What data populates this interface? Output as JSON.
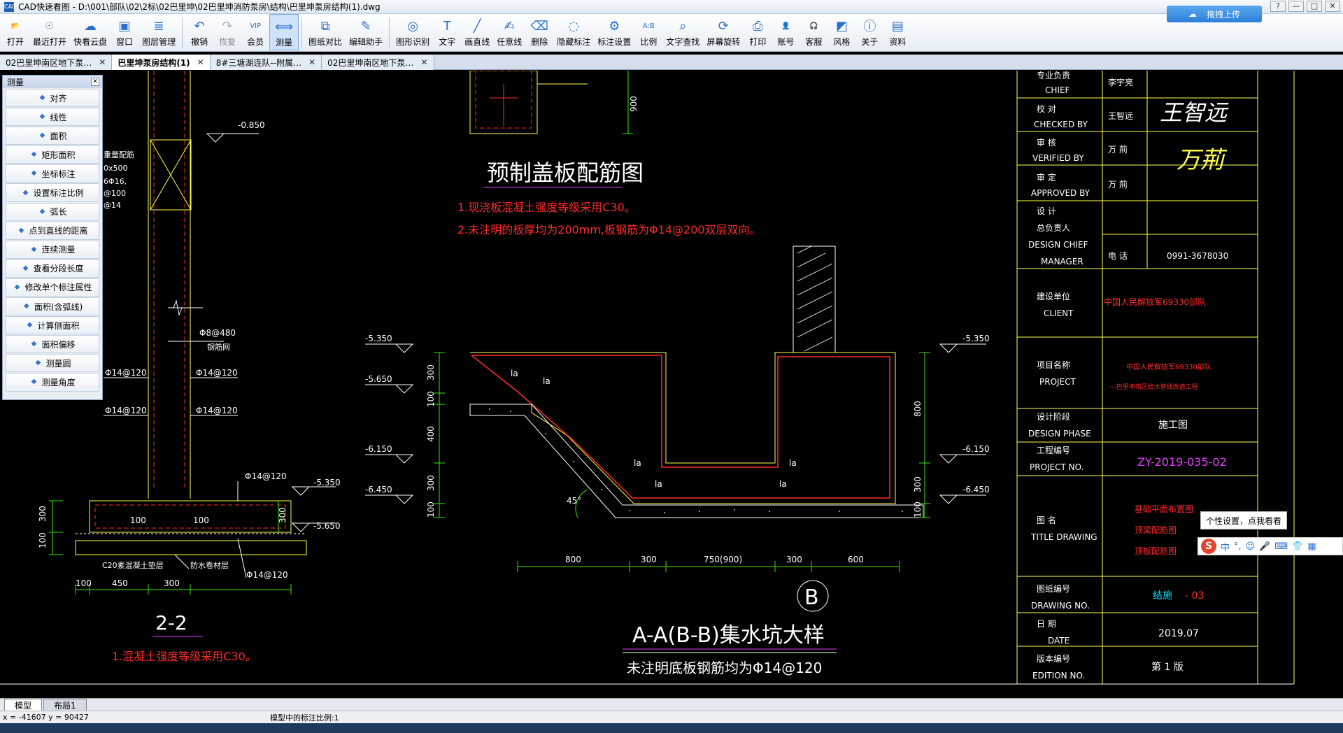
{
  "window": {
    "title": "CAD快速看图 - D:\\001\\部队\\02\\2标\\02巴里坤\\02巴里坤消防泵房\\结构\\巴里坤泵房结构(1).dwg",
    "app_icon": "CAD",
    "buttons": [
      "?",
      "—",
      "□",
      "✕"
    ]
  },
  "toolbar": {
    "items": [
      {
        "label": "打开",
        "icon": "folder-icon",
        "glyph": "📂"
      },
      {
        "label": "最近打开",
        "icon": "clock-icon",
        "glyph": "🕘"
      },
      {
        "label": "快看云盘",
        "icon": "cloud-icon",
        "glyph": "☁"
      },
      {
        "label": "窗口",
        "icon": "window-icon",
        "glyph": "▣"
      },
      {
        "label": "图层管理",
        "icon": "layers-icon",
        "glyph": "≣"
      },
      {
        "label": "撤销",
        "icon": "undo-icon",
        "glyph": "↶"
      },
      {
        "label": "恢复",
        "icon": "redo-icon",
        "glyph": "↷"
      },
      {
        "label": "会员",
        "icon": "vip-icon",
        "glyph": "VIP"
      },
      {
        "label": "测量",
        "icon": "measure-icon",
        "glyph": "⟺"
      },
      {
        "label": "图纸对比",
        "icon": "compare-icon",
        "glyph": "⧉"
      },
      {
        "label": "编辑助手",
        "icon": "edit-helper-icon",
        "glyph": "✎"
      },
      {
        "label": "图形识别",
        "icon": "shape-recognize-icon",
        "glyph": "◎"
      },
      {
        "label": "文字",
        "icon": "text-icon",
        "glyph": "T"
      },
      {
        "label": "画直线",
        "icon": "line-icon",
        "glyph": "╱"
      },
      {
        "label": "任意线",
        "icon": "freehand-icon",
        "glyph": "✍"
      },
      {
        "label": "删除",
        "icon": "eraser-icon",
        "glyph": "⌫"
      },
      {
        "label": "隐藏标注",
        "icon": "hide-icon",
        "glyph": "◌"
      },
      {
        "label": "标注设置",
        "icon": "annotation-settings-icon",
        "glyph": "⚙"
      },
      {
        "label": "比例",
        "icon": "scale-icon",
        "glyph": "A:B"
      },
      {
        "label": "文字查找",
        "icon": "find-text-icon",
        "glyph": "⌕"
      },
      {
        "label": "屏幕旋转",
        "icon": "rotate-icon",
        "glyph": "⟳"
      },
      {
        "label": "打印",
        "icon": "print-icon",
        "glyph": "⎙"
      },
      {
        "label": "账号",
        "icon": "account-icon",
        "glyph": "👤"
      },
      {
        "label": "客服",
        "icon": "support-icon",
        "glyph": "🎧"
      },
      {
        "label": "风格",
        "icon": "style-icon",
        "glyph": "◩"
      },
      {
        "label": "关于",
        "icon": "about-icon",
        "glyph": "ⓘ"
      },
      {
        "label": "资料",
        "icon": "docs-icon",
        "glyph": "▤"
      }
    ],
    "upload_label": "拖拽上传"
  },
  "tabs": [
    {
      "label": "02巴里坤南区地下泵…",
      "active": false
    },
    {
      "label": "巴里坤泵房结构(1)",
      "active": true
    },
    {
      "label": "8#三塘湖连队--附属…",
      "active": false
    },
    {
      "label": "02巴里坤南区地下泵…",
      "active": false
    }
  ],
  "measure_panel": {
    "title": "测量",
    "items": [
      {
        "label": "对齐",
        "icon": "align-measure-icon"
      },
      {
        "label": "线性",
        "icon": "linear-measure-icon"
      },
      {
        "label": "面积",
        "icon": "area-icon"
      },
      {
        "label": "矩形面积",
        "icon": "rect-area-icon"
      },
      {
        "label": "坐标标注",
        "icon": "coordinate-icon"
      },
      {
        "label": "设置标注比例",
        "icon": "scale-setting-icon"
      },
      {
        "label": "弧长",
        "icon": "arc-length-icon"
      },
      {
        "label": "点到直线的距离",
        "icon": "point-line-distance-icon"
      },
      {
        "label": "连续测量",
        "icon": "continuous-measure-icon"
      },
      {
        "label": "查看分段长度",
        "icon": "segment-length-icon"
      },
      {
        "label": "修改单个标注属性",
        "icon": "edit-annotation-icon"
      },
      {
        "label": "面积(含弧线)",
        "icon": "arc-area-icon"
      },
      {
        "label": "计算侧面积",
        "icon": "side-area-icon"
      },
      {
        "label": "面积偏移",
        "icon": "area-offset-icon"
      },
      {
        "label": "测量圆",
        "icon": "circle-measure-icon"
      },
      {
        "label": "测量角度",
        "icon": "angle-measure-icon"
      }
    ]
  },
  "drawing": {
    "left_dims": {
      "elev_top": "-0.850",
      "note_block": [
        "重量配筋",
        "0x500",
        "6Φ16,",
        "@100",
        "@14"
      ],
      "phi8": "Φ8@480",
      "mark": "钢筋网",
      "r1l": "Φ14@120",
      "r1r": "Φ14@120",
      "r2l": "Φ14@120",
      "r2r": "Φ14@120",
      "r3": "Φ14@120",
      "elev_a": "-5.350",
      "elev_b": "-5.650",
      "v300": "300",
      "v100": "100",
      "d100a": "100",
      "d100b": "100",
      "d300": "300",
      "bed": "C20素混凝土垫层",
      "waterproof": "防水卷材层",
      "r4": "Φ14@120",
      "b100": "100",
      "b450": "450",
      "b300": "300",
      "section": "2-2",
      "note": "1.混凝土强度等级采用C30。"
    },
    "cover": {
      "dim900": "900",
      "title": "预制盖板配筋图",
      "note1": "1.现浇板混凝土强度等级采用C30。",
      "note2": "2.未注明的板厚均为200mm,板钢筋为Φ14@200双层双向。"
    },
    "pit": {
      "elev_l1": "-5.350",
      "elev_l2": "-5.650",
      "elev_l3": "-6.150",
      "elev_l4": "-6.450",
      "elev_r1": "-5.350",
      "elev_r2": "-6.150",
      "elev_r3": "-6.450",
      "v300a": "300",
      "v100a": "100",
      "v400": "400",
      "v300b": "300",
      "v100b": "100",
      "r800": "800",
      "r300": "300",
      "r100": "100",
      "la": "la",
      "angle": "45°",
      "h800": "800",
      "h300a": "300",
      "h750": "750(900)",
      "h300b": "300",
      "h600": "600",
      "bubble": "B",
      "title": "A-A(B-B)集水坑大样",
      "note": "未注明底板钢筋均为Φ14@120"
    },
    "titleblock": {
      "chief_cn": "专业负责",
      "chief_en": "CHIEF",
      "chief_name": "李宇亮",
      "checked_cn": "校      对",
      "checked_en": "CHECKED BY",
      "checked_name": "王智远",
      "checked_sig": "王智远",
      "verified_cn": "审      核",
      "verified_en": "VERIFIED  BY",
      "verified_name": "万 荊",
      "verified_sig": "万荊",
      "approved_cn": "审      定",
      "approved_en": "APPROVED BY",
      "approved_name": "万 荊",
      "design_cn1": "设      计",
      "design_cn2": "总负责人",
      "design_en1": "DESIGN  CHIEF",
      "design_en2": "MANAGER",
      "phone_lbl": "电   话",
      "phone": "0991-3678030",
      "client_cn": "建设单位",
      "client_en": "CLIENT",
      "client_val": "中国人民解放军69330部队",
      "project_cn": "项目名称",
      "project_en": "PROJECT",
      "project_val1": "中国人民解放军69330部队",
      "project_val2": "---巴里坤南区给水管线改造工程",
      "phase_cn": "设计阶段",
      "phase_en": "DESIGN  PHASE",
      "phase_val": "施工图",
      "projno_cn": "工程编号",
      "projno_en": "PROJECT  NO.",
      "projno_val": "ZY-2019-035-02",
      "title_cn": "图      名",
      "title_en": "TITLE  DRAWING",
      "title_v1": "基础平面布置图",
      "title_v2": "顶梁配筋图",
      "title_v3": "顶板配筋图",
      "dwgno_cn": "图纸编号",
      "dwgno_en": "DRAWING  NO.",
      "dwgno_a": "结施",
      "dwgno_b": "- 03",
      "date_cn": "日      期",
      "date_en": "DATE",
      "date_val": "2019.07",
      "ed_cn": "版本编号",
      "ed_en": "EDITION  NO.",
      "ed_val": "第    1    版"
    }
  },
  "layout_tabs": [
    "模型",
    "布局1"
  ],
  "status": {
    "coords": "x = -41607  y = 90427",
    "scale": "模型中的标注比例:1"
  },
  "ime": {
    "tooltip": "个性设置，点我看看",
    "logo": "S",
    "items": [
      "中",
      "°,",
      "☺",
      "🎤",
      "⌨",
      "👕",
      "▦"
    ]
  },
  "colors": {
    "red": "#ff2a2a",
    "yellow": "#ffff4d",
    "green": "#39e600",
    "white": "#ffffff",
    "magenta": "#e040fb",
    "cyan": "#00e5ff"
  }
}
